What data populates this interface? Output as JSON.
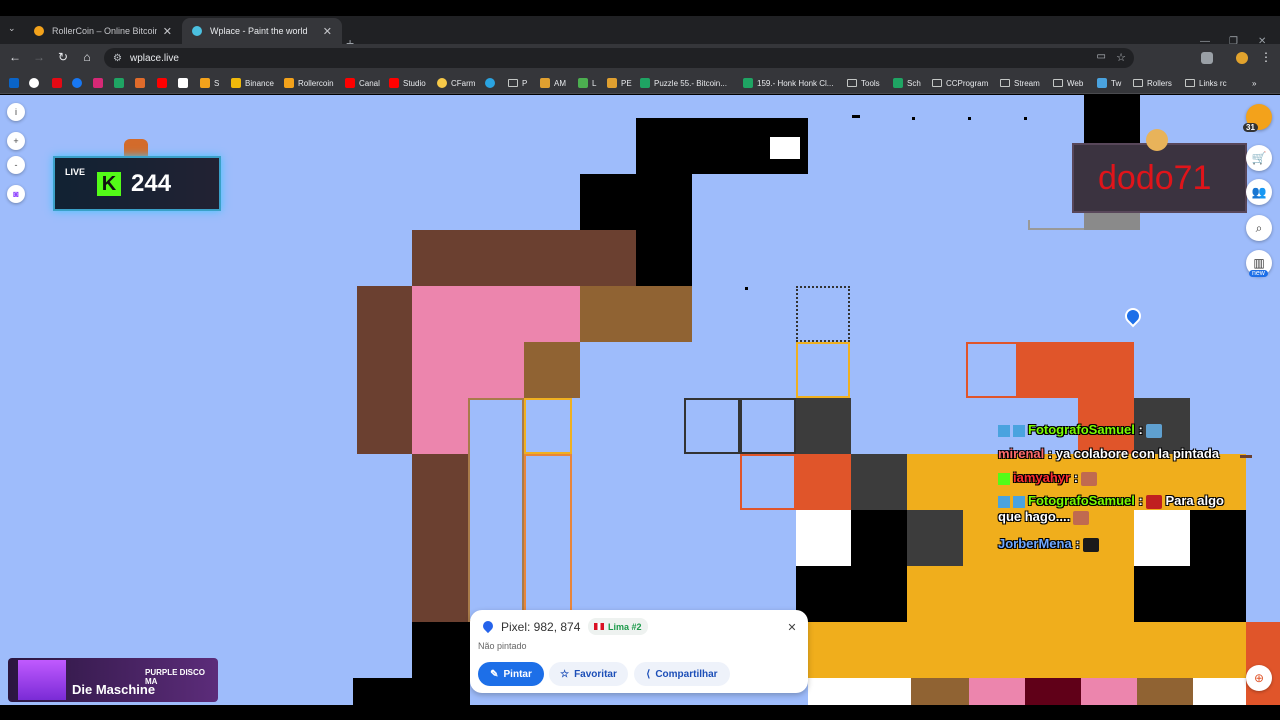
{
  "browser": {
    "tabs": [
      {
        "title": "RollerCoin – Online Bitcoin Mi",
        "active": false
      },
      {
        "title": "Wplace - Paint the world",
        "active": true
      }
    ],
    "url": "wplace.live",
    "bookmarks": [
      "S",
      "Binance",
      "Rollercoin",
      "Canal",
      "Studio",
      "CFarm",
      "P",
      "AM",
      "L",
      "PE",
      "Puzzle 55.- Bitcoin...",
      "159.- Honk Honk Cl...",
      "Tools",
      "Sch",
      "CCProgram",
      "Stream",
      "Web",
      "Tw",
      "Rollers",
      "Links rc"
    ]
  },
  "overlay": {
    "live_label": "LIVE",
    "viewer_count": "244",
    "sub_name": "dodo71",
    "level_badge": "31",
    "new_label": "new",
    "chat": [
      {
        "user": "FotografoSamuel",
        "user_color": "#7CFC00",
        "sep": " :",
        "text": ""
      },
      {
        "user": "mirenal",
        "user_color": "#ff6b6b",
        "sep": " :",
        "text": " ya colabore con la pintada"
      },
      {
        "user": "iamyahyr",
        "user_color": "#ff3030",
        "sep": " :",
        "text": ""
      },
      {
        "user": "FotografoSamuel",
        "user_color": "#7CFC00",
        "sep": " :",
        "text": " Para algo que hago...."
      },
      {
        "user": "JorberMena",
        "user_color": "#6fa8ff",
        "sep": " :",
        "text": ""
      }
    ],
    "music": {
      "line1": "PURPLE DISCO MA",
      "line2": "Die Maschine"
    }
  },
  "pixel_panel": {
    "title": "Pixel: 982, 874",
    "region": "Lima #2",
    "status": "Não pintado",
    "paint_label": "Pintar",
    "favorite_label": "Favoritar",
    "share_label": "Compartilhar"
  },
  "colors": {
    "canvas_bg": "#9ebcfb",
    "primary": "#1d6fe8",
    "kick_green": "#53fc18"
  }
}
